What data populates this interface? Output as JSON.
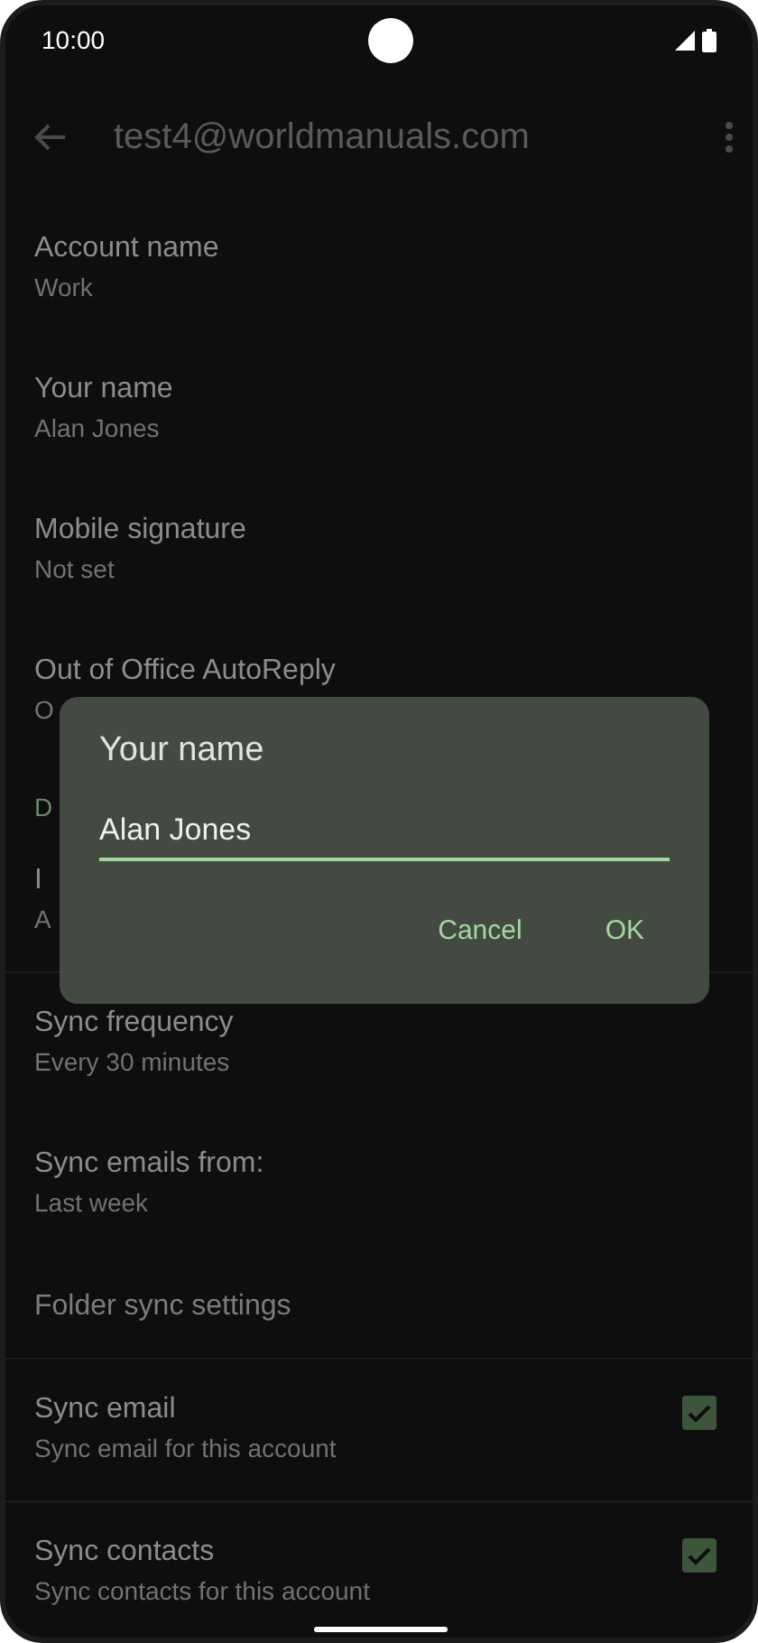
{
  "status_bar": {
    "time": "10:00"
  },
  "app_bar": {
    "title": "test4@worldmanuals.com"
  },
  "sections": [
    {
      "items": [
        {
          "kind": "item",
          "title": "Account name",
          "subtitle": "Work"
        },
        {
          "kind": "item",
          "title": "Your name",
          "subtitle": "Alan Jones"
        },
        {
          "kind": "item",
          "title": "Mobile signature",
          "subtitle": "Not set"
        },
        {
          "kind": "item",
          "title": "Out of Office AutoReply",
          "subtitle": "O"
        },
        {
          "kind": "header",
          "title": "D"
        },
        {
          "kind": "item",
          "title": "I",
          "subtitle": "A"
        }
      ]
    },
    {
      "items": [
        {
          "kind": "item",
          "title": "Sync frequency",
          "subtitle": "Every 30 minutes"
        },
        {
          "kind": "item",
          "title": "Sync emails from:",
          "subtitle": "Last week"
        },
        {
          "kind": "single",
          "title": "Folder sync settings"
        }
      ]
    },
    {
      "items": [
        {
          "kind": "checkbox",
          "title": "Sync email",
          "subtitle": "Sync email for this account",
          "checked": true
        }
      ]
    },
    {
      "items": [
        {
          "kind": "checkbox",
          "title": "Sync contacts",
          "subtitle": "Sync contacts for this account",
          "checked": true
        }
      ]
    }
  ],
  "dialog": {
    "title": "Your name",
    "value": "Alan Jones",
    "buttons": [
      "Cancel",
      "OK"
    ]
  }
}
